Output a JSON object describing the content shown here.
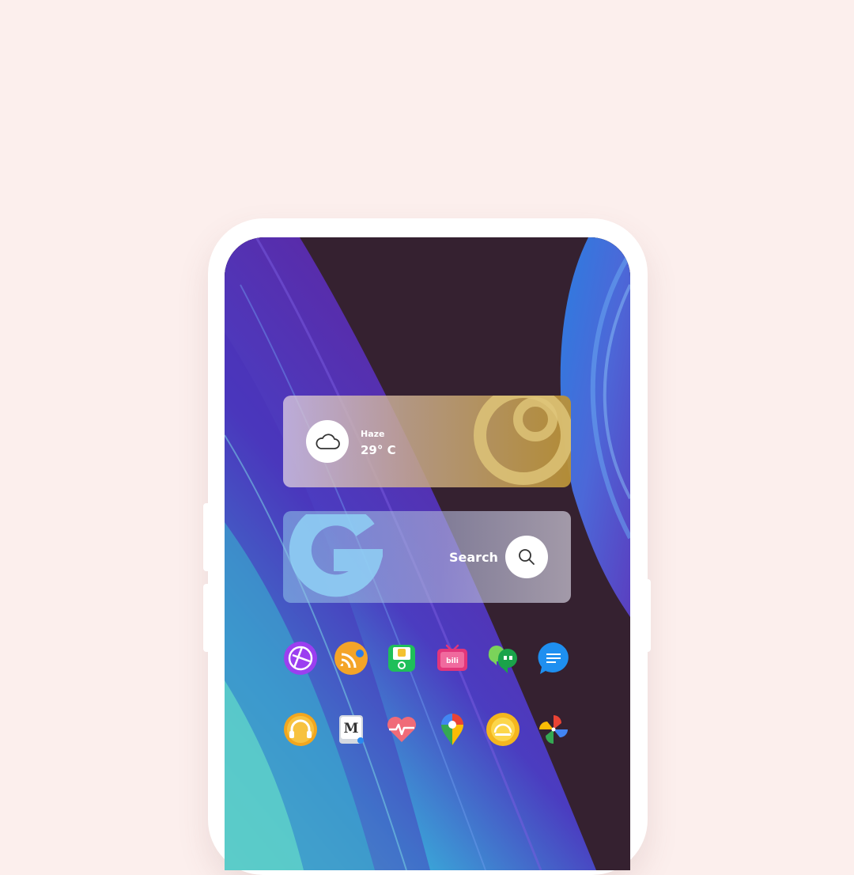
{
  "weather": {
    "condition": "Haze",
    "temperature": "29° C",
    "icon": "cloud-icon"
  },
  "search": {
    "label": "Search",
    "logo": "google-g-logo",
    "icon": "search-icon"
  },
  "apps_row_1": [
    "browser-icon",
    "cast-icon",
    "money-icon",
    "bilibili-icon",
    "hangouts-icon",
    "messenger-icon"
  ],
  "apps_row_2": [
    "headphones-icon",
    "medium-icon",
    "heart-rate-icon",
    "maps-icon",
    "weather-sun-icon",
    "pinwheel-icon"
  ],
  "colors": {
    "background": "#fcefed",
    "wallpaper_dark": "#352130",
    "wallpaper_purple": "#5a2bb0",
    "wallpaper_teal": "#4fd0c8",
    "weather_accent": "#b8922f"
  }
}
